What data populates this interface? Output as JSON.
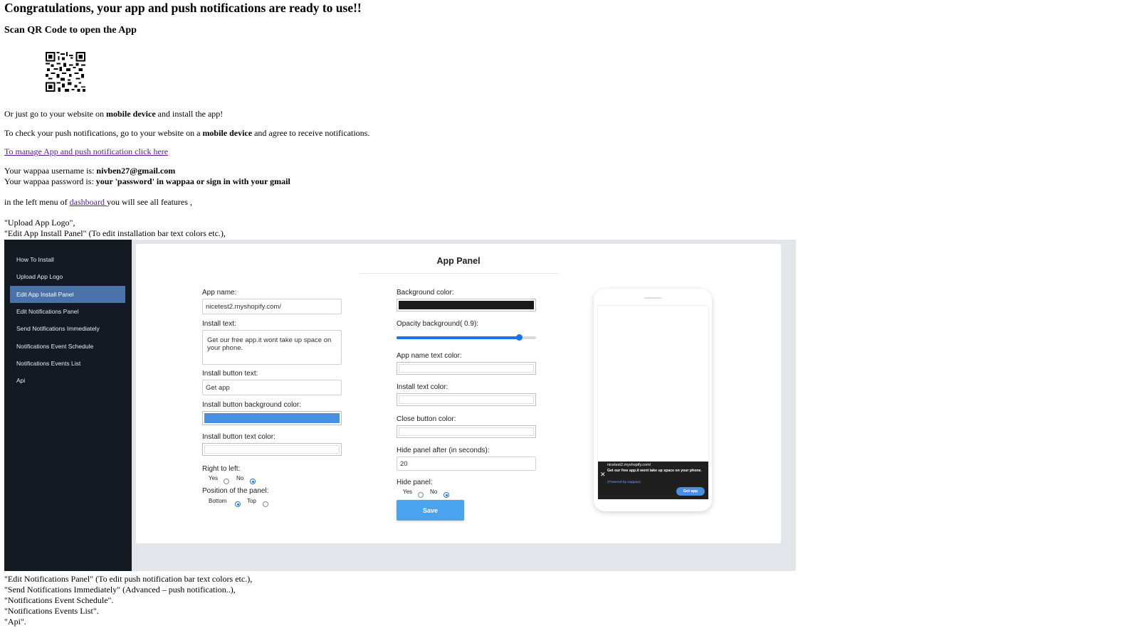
{
  "header": {
    "title": "Congratulations, your app and push notifications are ready to use!!",
    "scan": "Scan QR Code to open the App"
  },
  "body": {
    "mobile_pre": "Or just go to your website on ",
    "mobile_bold": "mobile device",
    "mobile_post": " and install the app!",
    "push_pre": "To check your push notifications, go to your website on a ",
    "push_bold": "mobile device",
    "push_post": " and agree to receive notifications.",
    "manage_link": "To manage App and push notification click here",
    "username_pre": "Your wappaa username is: ",
    "username_val": "nivben27@gmail.com",
    "password_pre": "Your wappaa password is: ",
    "password_val": "your 'password' in wappaa or sign in with your gmail",
    "menu_pre": "in the left menu of ",
    "menu_link": "dashboard ",
    "menu_post": "you will see all features ,",
    "feature_1": "\"Upload App Logo\",",
    "feature_2": "\"Edit App Install Panel\" (To edit installation bar text colors etc.),",
    "feature_3": "\"Edit Notifications Panel\" (To edit push notification bar text colors etc.),",
    "feature_4": "\"Send Notifications Immediately\" (Advanced – push notification..),",
    "feature_5": "\"Notifications Event Schedule\".",
    "feature_6": "\"Notifications Events List\".",
    "feature_7": "\"Api\"."
  },
  "sidebar": {
    "items": [
      {
        "label": "How To Install"
      },
      {
        "label": "Upload App Logo"
      },
      {
        "label": "Edit App Install Panel"
      },
      {
        "label": "Edit Notifications Panel"
      },
      {
        "label": "Send Notifications Immediately"
      },
      {
        "label": "Notifications Event Schedule"
      },
      {
        "label": "Notifications Events List"
      },
      {
        "label": "Api"
      }
    ],
    "active_index": 2
  },
  "panel": {
    "title": "App Panel",
    "app_name_label": "App name:",
    "app_name_value": "nicetest2.myshopify.com/",
    "install_text_label": "Install text:",
    "install_text_value": "Get our free app.it wont take up space on your phone.",
    "install_button_text_label": "Install button text:",
    "install_button_text_value": "Get app",
    "install_button_bg_label": "Install button background color:",
    "install_button_bg_color": "#4a90e2",
    "install_button_text_color_label": "Install button text color:",
    "install_button_text_color": "#ffffff",
    "rtl_label": "Right to left:",
    "yes": "Yes",
    "no": "No",
    "rtl_selected": "No",
    "position_label": "Position of the panel:",
    "bottom": "Bottom",
    "top": "Top",
    "position_selected": "Bottom",
    "bg_color_label": "Background color:",
    "bg_color": "#1a1a1a",
    "opacity_label": "Opacity background( 0.9):",
    "opacity_value": 0.9,
    "app_name_color_label": "App name text color:",
    "app_name_color": "#ffffff",
    "install_text_color_label": "Install text color:",
    "install_text_color": "#ffffff",
    "close_color_label": "Close button color:",
    "close_color": "#ffffff",
    "hide_after_label": "Hide panel after (in seconds):",
    "hide_after_value": "20",
    "hide_panel_label": "Hide panel:",
    "hide_panel_selected": "No",
    "save_label": "Save"
  },
  "preview": {
    "app_name": "nicetest2.myshopify.com/",
    "text": "Get our free app.it wont take up space on your phone.",
    "powered": "(Powered by wappaa)",
    "button": "Get app",
    "close_glyph": "✕"
  }
}
